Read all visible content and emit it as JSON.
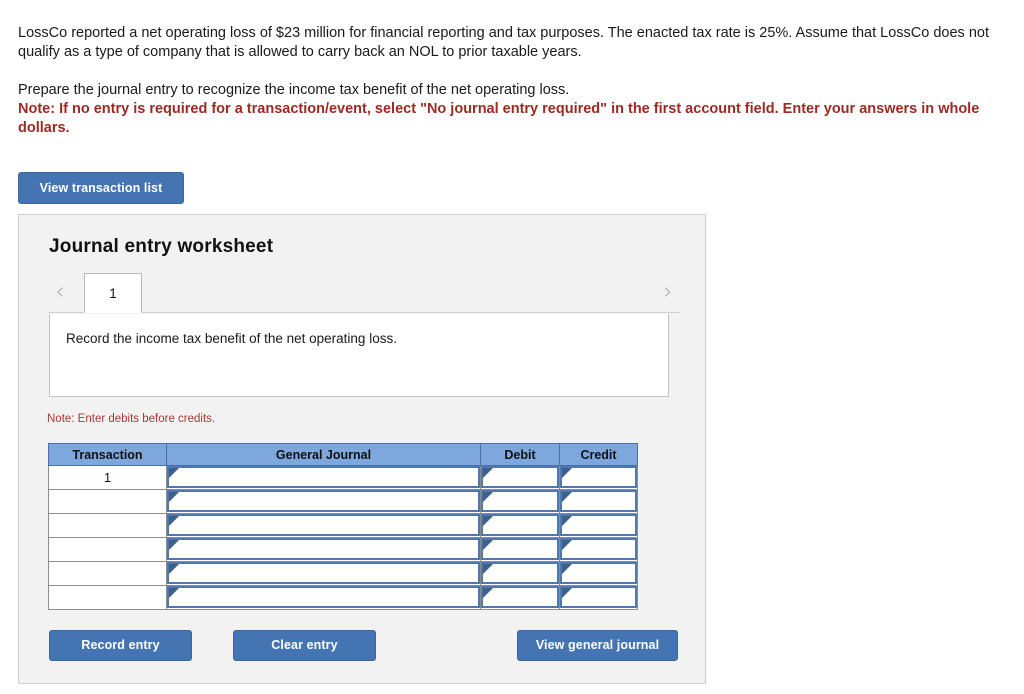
{
  "problem": {
    "paragraph1": "LossCo reported a net operating loss of $23 million for financial reporting and tax purposes. The enacted tax rate is 25%. Assume that LossCo does not qualify as a type of company that is allowed to carry back an NOL to prior taxable years.",
    "paragraph2": "Prepare the journal entry to recognize the income tax benefit of the net operating loss.",
    "note": "Note: If no entry is required for a transaction/event, select \"No journal entry required\" in the first account field. Enter your answers in whole dollars."
  },
  "toolbar": {
    "view_transaction_list_label": "View transaction list"
  },
  "worksheet": {
    "title": "Journal entry worksheet",
    "prev_icon": "‹",
    "next_icon": "›",
    "tabs": [
      {
        "label": "1"
      }
    ],
    "description": "Record the income tax benefit of the net operating loss.",
    "debits_note": "Note: Enter debits before credits.",
    "table": {
      "columns": [
        "Transaction",
        "General Journal",
        "Debit",
        "Credit"
      ],
      "rows": [
        {
          "transaction": "1",
          "general_journal": "",
          "debit": "",
          "credit": ""
        },
        {
          "transaction": "",
          "general_journal": "",
          "debit": "",
          "credit": ""
        },
        {
          "transaction": "",
          "general_journal": "",
          "debit": "",
          "credit": ""
        },
        {
          "transaction": "",
          "general_journal": "",
          "debit": "",
          "credit": ""
        },
        {
          "transaction": "",
          "general_journal": "",
          "debit": "",
          "credit": ""
        },
        {
          "transaction": "",
          "general_journal": "",
          "debit": "",
          "credit": ""
        }
      ]
    },
    "buttons": {
      "record_entry": "Record entry",
      "clear_entry": "Clear entry",
      "view_general_journal": "View general journal"
    }
  },
  "colors": {
    "button_blue": "#4574b3",
    "table_header_blue": "#7da7dd",
    "field_border_blue": "#4d79b0",
    "note_red": "#9c2a22",
    "panel_gray": "#f2f2f2"
  }
}
